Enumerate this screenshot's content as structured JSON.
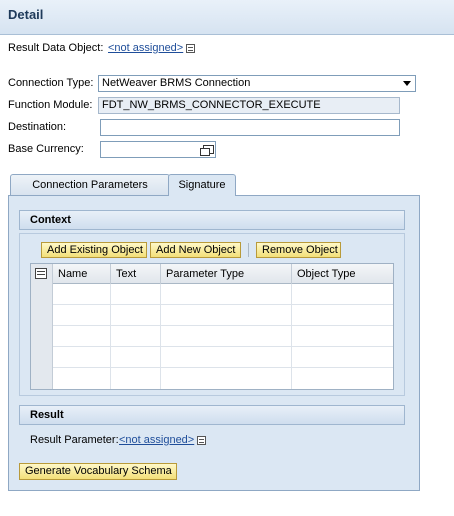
{
  "header": {
    "title": "Detail"
  },
  "result_data_object": {
    "label": "Result Data Object:",
    "value": "<not assigned>"
  },
  "form": {
    "connection_type": {
      "label": "Connection Type:",
      "value": "NetWeaver BRMS  Connection"
    },
    "function_module": {
      "label": "Function Module:",
      "value": "FDT_NW_BRMS_CONNECTOR_EXECUTE"
    },
    "destination": {
      "label": "Destination:",
      "value": ""
    },
    "base_currency": {
      "label": "Base Currency:",
      "value": ""
    }
  },
  "tabs": [
    {
      "label": "Connection Parameters",
      "active": false
    },
    {
      "label": "Signature",
      "active": true
    }
  ],
  "context": {
    "title": "Context",
    "buttons": {
      "add_existing": "Add Existing Object",
      "add_new": "Add New Object",
      "remove": "Remove Object"
    },
    "table": {
      "columns": [
        "Name",
        "Text",
        "Parameter Type",
        "Object Type"
      ],
      "rows": [
        [
          "",
          "",
          "",
          ""
        ],
        [
          "",
          "",
          "",
          ""
        ],
        [
          "",
          "",
          "",
          ""
        ],
        [
          "",
          "",
          "",
          ""
        ],
        [
          "",
          "",
          "",
          ""
        ]
      ]
    }
  },
  "result": {
    "title": "Result",
    "param_label": "Result Parameter:",
    "param_value": "<not assigned>"
  },
  "generate_button": "Generate Vocabulary Schema",
  "icons": {
    "value_help": "value-help-icon",
    "dropdown": "chevron-down-icon",
    "currency_help": "calendar-icon",
    "column_select": "column-select-icon"
  }
}
